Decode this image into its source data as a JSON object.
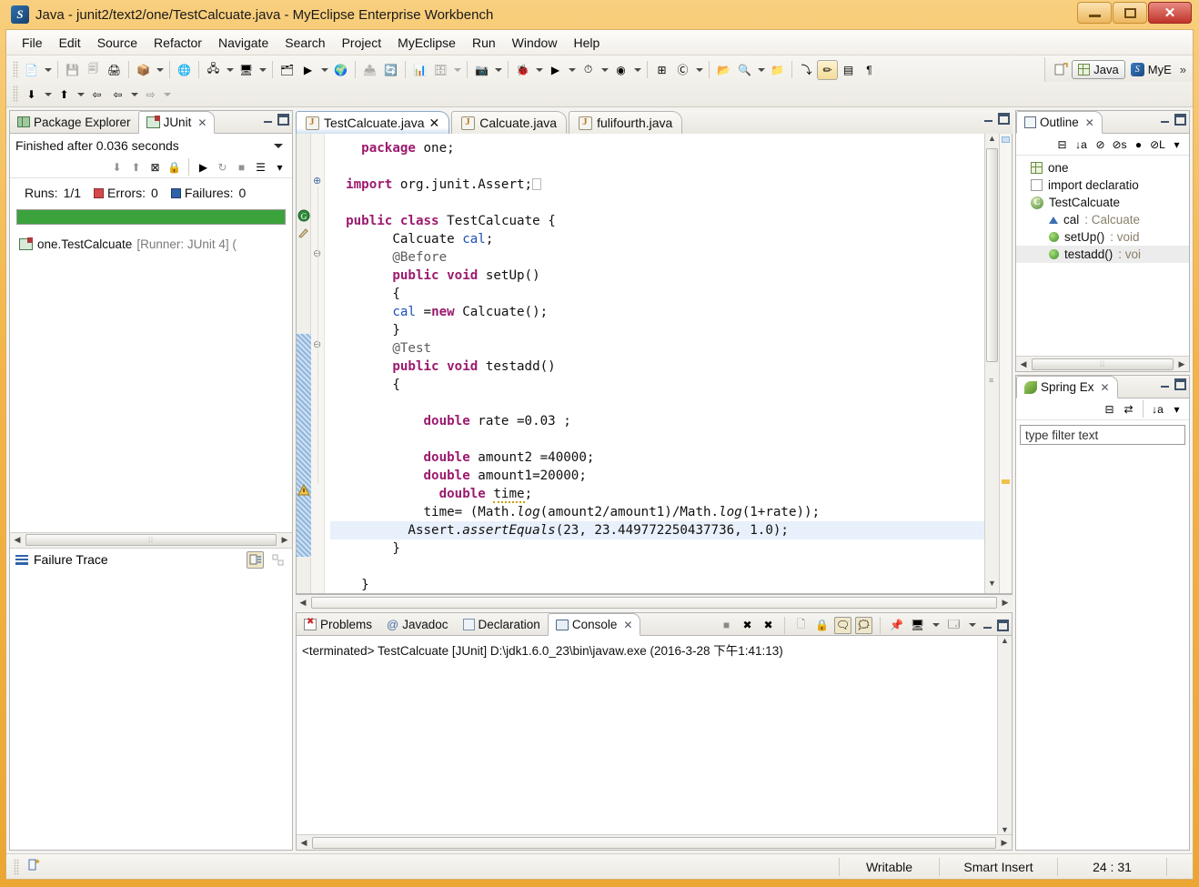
{
  "window": {
    "title": "Java - junit2/text2/one/TestCalcuate.java - MyEclipse Enterprise Workbench",
    "app_icon": "myeclipse-icon",
    "controls": {
      "minimize": "minimize-button",
      "maximize": "maximize-button",
      "close": "✕"
    }
  },
  "menubar": {
    "items": [
      "File",
      "Edit",
      "Source",
      "Refactor",
      "Navigate",
      "Search",
      "Project",
      "MyEclipse",
      "Run",
      "Window",
      "Help"
    ]
  },
  "toolbar": {
    "row1": [
      {
        "name": "new-wizard-icon",
        "glyph": "📄",
        "arrow": true
      },
      {
        "sep": true
      },
      {
        "name": "save-icon",
        "glyph": "💾",
        "disabled": true
      },
      {
        "name": "save-all-icon",
        "glyph": "🗐",
        "disabled": true
      },
      {
        "name": "print-icon",
        "glyph": "🖨"
      },
      {
        "sep": true
      },
      {
        "name": "deploy-icon",
        "glyph": "📦",
        "arrow": true
      },
      {
        "sep": true
      },
      {
        "name": "web-browser-icon",
        "glyph": "🌐"
      },
      {
        "sep": true
      },
      {
        "name": "new-server-icon",
        "glyph": "🖧",
        "arrow": true
      },
      {
        "name": "manage-server-icon",
        "glyph": "🖥",
        "arrow": true
      },
      {
        "sep": true
      },
      {
        "name": "open-type-icon",
        "glyph": "🗂"
      },
      {
        "name": "run-server-icon",
        "glyph": "▶",
        "arrow": true
      },
      {
        "name": "globe-icon",
        "glyph": "🌍"
      },
      {
        "sep": true
      },
      {
        "name": "open-task-icon",
        "glyph": "📤",
        "disabled": true
      },
      {
        "name": "sync-icon",
        "glyph": "🔄"
      },
      {
        "sep": true
      },
      {
        "name": "new-report-icon",
        "glyph": "📊"
      },
      {
        "name": "db-browser-icon",
        "glyph": "🗄",
        "arrow": true,
        "disabled": true
      },
      {
        "sep": true
      },
      {
        "name": "snapshot-icon",
        "glyph": "📷",
        "arrow": true
      },
      {
        "sep": true
      },
      {
        "name": "debug-icon",
        "glyph": "🐞",
        "arrow": true
      },
      {
        "name": "run-icon",
        "glyph": "▶",
        "arrow": true
      },
      {
        "name": "run-external-icon",
        "glyph": "⏱",
        "arrow": true
      },
      {
        "name": "coverage-icon",
        "glyph": "◉",
        "arrow": true
      },
      {
        "sep": true
      },
      {
        "name": "new-package-icon",
        "glyph": "⊞"
      },
      {
        "name": "new-class-icon",
        "glyph": "Ⓒ",
        "arrow": true
      },
      {
        "sep": true
      },
      {
        "name": "open-resource-icon",
        "glyph": "📂"
      },
      {
        "name": "search-icon",
        "glyph": "🔍",
        "arrow": true
      },
      {
        "name": "open-folder-icon",
        "glyph": "📁"
      },
      {
        "sep": true
      },
      {
        "name": "next-annotation-icon",
        "glyph": "⤵"
      },
      {
        "name": "toggle-markers-icon",
        "glyph": "✏",
        "selected": true
      },
      {
        "name": "show-whitespace-icon",
        "glyph": "▤"
      },
      {
        "name": "toggle-block-selection-icon",
        "glyph": "¶"
      }
    ],
    "row2": [
      {
        "name": "next-edit-icon",
        "glyph": "⬇",
        "arrow": true
      },
      {
        "name": "prev-edit-icon",
        "glyph": "⬆",
        "arrow": true
      },
      {
        "name": "back-history-icon",
        "glyph": "⇦",
        "arrow": false
      },
      {
        "name": "back-icon",
        "glyph": "⇦",
        "arrow": true
      },
      {
        "name": "forward-icon",
        "glyph": "⇨",
        "arrow": true,
        "disabled": true
      }
    ],
    "perspectives": {
      "open_perspective": "open-perspective-icon",
      "items": [
        {
          "label": "Java",
          "active": true,
          "icon": "java-perspective-icon"
        },
        {
          "label": "MyE",
          "active": false,
          "icon": "myeclipse-perspective-icon"
        }
      ],
      "overflow": "»"
    }
  },
  "junit_view": {
    "tabs": [
      {
        "label": "Package Explorer",
        "active": false,
        "icon": "package-explorer-icon"
      },
      {
        "label": "JUnit",
        "active": true,
        "icon": "junit-icon",
        "closable": true
      }
    ],
    "status": "Finished after 0.036 seconds",
    "toolbar": [
      {
        "name": "next-failure-icon",
        "glyph": "⬇",
        "disabled": true
      },
      {
        "name": "previous-failure-icon",
        "glyph": "⬆",
        "disabled": true
      },
      {
        "name": "show-failures-only-icon",
        "glyph": "⊠"
      },
      {
        "name": "lock-scroll-icon",
        "glyph": "🔒"
      },
      {
        "sep": true
      },
      {
        "name": "rerun-test-icon",
        "glyph": "▶"
      },
      {
        "name": "rerun-failed-icon",
        "glyph": "↻",
        "disabled": true
      },
      {
        "name": "stop-icon",
        "glyph": "■",
        "disabled": true
      },
      {
        "name": "test-history-icon",
        "glyph": "☰"
      },
      {
        "name": "view-menu-icon",
        "glyph": "▾"
      }
    ],
    "counts": {
      "runs_label": "Runs:",
      "runs_value": "1/1",
      "errors_label": "Errors:",
      "errors_value": "0",
      "failures_label": "Failures:",
      "failures_value": "0"
    },
    "progress_color": "#3ba33b",
    "tree": [
      {
        "name": "one.TestCalcuate",
        "meta": "[Runner: JUnit 4] (",
        "icon": "test-suite-icon"
      }
    ],
    "failure_trace": {
      "label": "Failure Trace",
      "icon": "failure-trace-icon",
      "buttons": [
        {
          "name": "filter-stack-trace-icon",
          "glyph": "⇥",
          "selected": true
        },
        {
          "name": "compare-results-icon",
          "glyph": "⊞",
          "disabled": true
        }
      ]
    }
  },
  "editor": {
    "tabs": [
      {
        "label": "TestCalcuate.java",
        "active": true,
        "closable": true,
        "icon": "java-file-icon"
      },
      {
        "label": "Calcuate.java",
        "active": false,
        "closable": false,
        "icon": "java-file-icon"
      },
      {
        "label": "fulifourth.java",
        "active": false,
        "closable": false,
        "icon": "java-file-icon"
      }
    ],
    "code_lines": [
      "    package one;",
      "",
      "  import org.junit.Assert;",
      "",
      "  public class TestCalcuate {",
      "        Calcuate cal;",
      "        @Before",
      "        public void setUp()",
      "        {",
      "        cal =new Calcuate();",
      "        }",
      "        @Test",
      "        public void testadd()",
      "        {",
      "",
      "            double rate =0.03 ;",
      "",
      "            double amount2 =40000;",
      "            double amount1=20000;",
      "              double time;",
      "            time= (Math.log(amount2/amount1)/Math.log(1+rate));",
      "          Assert.assertEquals(23, 23.449772250437736, 1.0);",
      "        }",
      "",
      "    }"
    ],
    "highlighted_line_index": 21,
    "gutter_markers": [
      {
        "name": "breakpoint-overview-icon",
        "row": 4
      },
      {
        "name": "warning-marker-icon",
        "row": 19
      }
    ],
    "fold_markers": [
      {
        "name": "fold-expand-icon",
        "row": 2,
        "glyph": "⊕"
      },
      {
        "name": "fold-collapse-icon",
        "row": 6,
        "glyph": "⊖"
      },
      {
        "name": "fold-collapse-icon",
        "row": 11,
        "glyph": "⊖"
      }
    ]
  },
  "console_view": {
    "tabs": [
      {
        "label": "Problems",
        "active": false,
        "icon": "problems-icon"
      },
      {
        "label": "Javadoc",
        "active": false,
        "icon": "javadoc-icon"
      },
      {
        "label": "Declaration",
        "active": false,
        "icon": "declaration-icon"
      },
      {
        "label": "Console",
        "active": true,
        "icon": "console-icon",
        "closable": true
      }
    ],
    "output": "<terminated> TestCalcuate [JUnit] D:\\jdk1.6.0_23\\bin\\javaw.exe (2016-3-28 下午1:41:13)",
    "toolbar": [
      {
        "name": "terminate-icon",
        "glyph": "■",
        "disabled": true
      },
      {
        "name": "remove-launch-icon",
        "glyph": "✖"
      },
      {
        "name": "remove-all-terminated-icon",
        "glyph": "✖"
      },
      {
        "sep": true
      },
      {
        "name": "clear-console-icon",
        "glyph": "🗋",
        "disabled": true
      },
      {
        "name": "scroll-lock-icon",
        "glyph": "🔒"
      },
      {
        "name": "show-console-on-output-icon",
        "glyph": "🗨",
        "selected": true
      },
      {
        "name": "show-console-on-error-icon",
        "glyph": "🗯",
        "selected": true
      },
      {
        "sep": true
      },
      {
        "name": "pin-console-icon",
        "glyph": "📌"
      },
      {
        "name": "display-selected-console-icon",
        "glyph": "🖥",
        "arrow": true
      },
      {
        "name": "open-console-icon",
        "glyph": "🗔",
        "arrow": true
      }
    ]
  },
  "outline_view": {
    "tab_label": "Outline",
    "tab_icon": "outline-icon",
    "toolbar": [
      {
        "name": "collapse-all-icon",
        "glyph": "⊟"
      },
      {
        "name": "sort-icon",
        "glyph": "↓a"
      },
      {
        "name": "hide-fields-icon",
        "glyph": "⊘"
      },
      {
        "name": "hide-static-icon",
        "glyph": "⊘s"
      },
      {
        "name": "hide-non-public-icon",
        "glyph": "●"
      },
      {
        "name": "hide-local-types-icon",
        "glyph": "⊘L"
      },
      {
        "name": "view-menu-icon",
        "glyph": "▾"
      }
    ],
    "items": [
      {
        "label": "one",
        "type": "",
        "icon": "package-icon",
        "indent": 0,
        "selected": false
      },
      {
        "label": "import declaratio",
        "type": "",
        "icon": "import-declarations-icon",
        "indent": 0,
        "selected": false
      },
      {
        "label": "TestCalcuate",
        "type": "",
        "icon": "class-icon",
        "indent": 0,
        "selected": false
      },
      {
        "label": "cal",
        "type": " : Calcuate",
        "icon": "field-icon",
        "indent": 1,
        "selected": false
      },
      {
        "label": "setUp()",
        "type": " : void",
        "icon": "method-public-icon",
        "indent": 1,
        "selected": false
      },
      {
        "label": "testadd()",
        "type": " : voi",
        "icon": "method-annotated-icon",
        "indent": 1,
        "selected": true
      }
    ]
  },
  "spring_view": {
    "tab_label": "Spring Ex",
    "tab_icon": "spring-icon",
    "toolbar": [
      {
        "name": "collapse-all-icon",
        "glyph": "⊟"
      },
      {
        "name": "link-with-editor-icon",
        "glyph": "⇄"
      },
      {
        "sep": true
      },
      {
        "name": "sort-icon",
        "glyph": "↓a"
      },
      {
        "name": "view-menu-icon",
        "glyph": "▾"
      }
    ],
    "filter_placeholder": "type filter text"
  },
  "statusbar": {
    "left_icon": "editor-status-icon",
    "cells": [
      "Writable",
      "Smart Insert",
      "24 : 31"
    ]
  },
  "colors": {
    "accent": "#f3b548",
    "progress_green": "#3ba33b",
    "keyword": "#9c1a6e",
    "annotation": "#5c5c5c",
    "field": "#1b50b5",
    "selection": "#e8f0fb"
  }
}
